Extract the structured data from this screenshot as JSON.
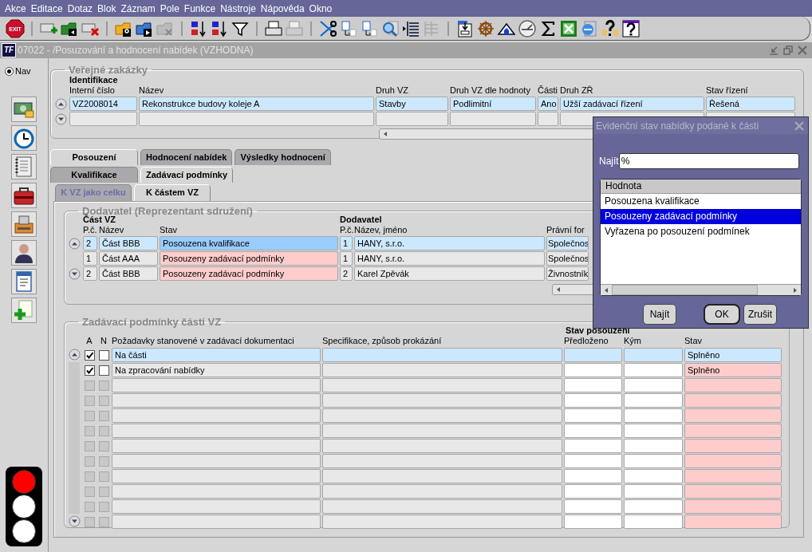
{
  "menu": [
    "Akce",
    "Editace",
    "Dotaz",
    "Blok",
    "Záznam",
    "Pole",
    "Funkce",
    "Nástroje",
    "Nápověda",
    "Okno"
  ],
  "toolbar": {
    "exit_label": "EXIT"
  },
  "window": {
    "logo": "TF",
    "title": "07022 - /Posuzování a hodnocení nabídek (VZHODNA)"
  },
  "nav": {
    "label": "Nav",
    "selected": true
  },
  "traffic_light": {
    "red": true,
    "amber": false,
    "green": false
  },
  "zakazky": {
    "title": "Veřejné zakázky",
    "group": "Identifikace",
    "columns": [
      "Interní číslo",
      "Název",
      "Druh VZ",
      "Druh VZ dle hodnoty",
      "Části",
      "Druh ZŘ",
      "Stav řízení"
    ],
    "rows": [
      [
        "VZ2008014",
        "Rekonstrukce budovy koleje A",
        "Stavby",
        "Podlimitní",
        "Ano",
        "Užší zadávací řízení",
        "Řešená"
      ]
    ]
  },
  "tabs": [
    {
      "label": "Posouzení",
      "selected": true
    },
    {
      "label": "Hodnocení nabídek",
      "selected": false
    },
    {
      "label": "Výsledky hodnocení",
      "selected": false
    }
  ],
  "subtabs": [
    {
      "label": "Kvalifikace",
      "selected": false
    },
    {
      "label": "Zadávací podmínky",
      "selected": true
    }
  ],
  "part_tabs": [
    {
      "label": "K VZ jako celku",
      "selected": false
    },
    {
      "label": "K částem VZ",
      "selected": true
    }
  ],
  "dodavatel": {
    "title": "Dodavatel (Reprezentant sdružení)",
    "group_part": "Část VZ",
    "group_supplier": "Dodavatel",
    "columns": [
      "P.č.",
      "Název",
      "Stav",
      "P.č.",
      "Název, jméno",
      "Právní for"
    ],
    "rows": [
      {
        "selected": true,
        "cells": [
          "2",
          "Část BBB",
          "Posouzena kvalifikace",
          "1",
          "HANY, s.r.o.",
          "Společnos"
        ]
      },
      {
        "selected": false,
        "cells": [
          "1",
          "Část AAA",
          "Posouzeny zadávací podmínky",
          "1",
          "HANY, s.r.o.",
          "Společnos"
        ]
      },
      {
        "selected": false,
        "cells": [
          "2",
          "Část BBB",
          "Posouzeny zadávací podmínky",
          "2",
          "Karel Zpěvák",
          "Živnostník"
        ]
      }
    ]
  },
  "podminky": {
    "title": "Zadávací podmínky části VZ",
    "group": "Stav posouzení",
    "columns": [
      "A",
      "N",
      "Požadavky stanovené v zadávací dokumentaci",
      "Specifikace, způsob prokázání",
      "Předloženo",
      "Kým",
      "Stav"
    ],
    "rows": [
      {
        "selected": true,
        "a_checked": true,
        "n_checked": false,
        "requirement": "Na části",
        "status": "Splněno"
      },
      {
        "selected": false,
        "a_checked": true,
        "n_checked": false,
        "requirement": "Na zpracování nabídky",
        "status": "Splněno"
      }
    ]
  },
  "dialog": {
    "title": "Evidenční stav nabídky podané k části",
    "find_label": "Najít",
    "find_value": "%",
    "column": "Hodnota",
    "items": [
      {
        "label": "Posouzena kvalifikace",
        "selected": false
      },
      {
        "label": "Posouzeny zadávací podmínky",
        "selected": true
      },
      {
        "label": "Vyřazena po posouzení podmínek",
        "selected": false
      }
    ],
    "buttons": [
      {
        "label": "Najít",
        "default": false
      },
      {
        "label": "OK",
        "default": true
      },
      {
        "label": "Zrušit",
        "default": false
      }
    ]
  }
}
